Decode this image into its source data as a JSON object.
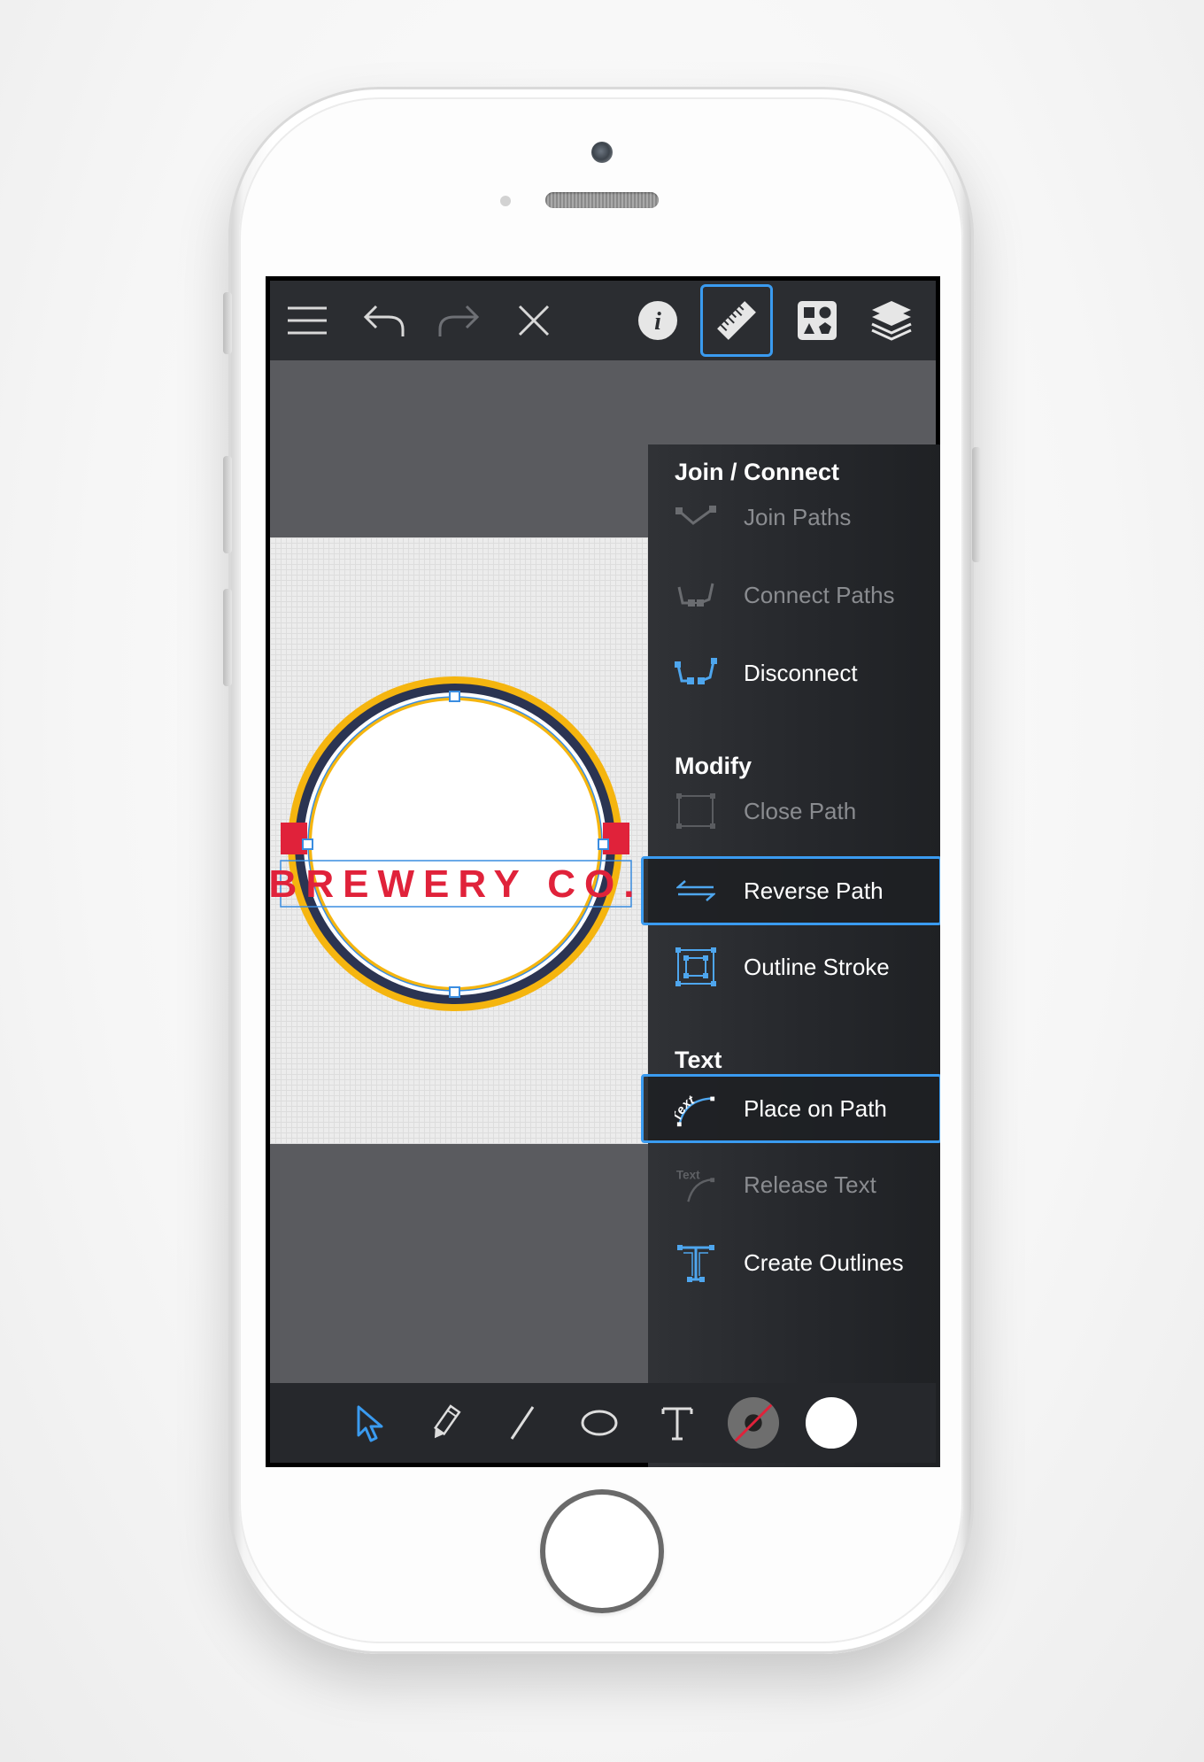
{
  "toolbar": {
    "icons": [
      "menu-icon",
      "undo-icon",
      "redo-icon",
      "close-icon",
      "info-icon",
      "ruler-icon",
      "shapes-icon",
      "layers-icon"
    ],
    "active": "ruler-icon",
    "accent": "#3a9bf0"
  },
  "artwork": {
    "text": "BREWERY CO.",
    "colors": {
      "ring": "#f5b50f",
      "inner_ring": "#2b3452",
      "text": "#e0223a",
      "selection": "#3a8de0"
    }
  },
  "panel": {
    "sections": [
      {
        "title": "Join / Connect",
        "items": [
          {
            "label": "Join Paths",
            "icon": "join-paths-icon",
            "state": "disabled"
          },
          {
            "label": "Connect Paths",
            "icon": "connect-paths-icon",
            "state": "disabled"
          },
          {
            "label": "Disconnect",
            "icon": "disconnect-icon",
            "state": "enabled"
          }
        ]
      },
      {
        "title": "Modify",
        "items": [
          {
            "label": "Close Path",
            "icon": "close-path-icon",
            "state": "disabled"
          },
          {
            "label": "Reverse Path",
            "icon": "reverse-path-icon",
            "state": "selected"
          },
          {
            "label": "Outline Stroke",
            "icon": "outline-stroke-icon",
            "state": "enabled"
          }
        ]
      },
      {
        "title": "Text",
        "items": [
          {
            "label": "Place on Path",
            "icon": "place-on-path-icon",
            "state": "selected",
            "icon_text": "Text"
          },
          {
            "label": "Release Text",
            "icon": "release-text-icon",
            "state": "disabled",
            "icon_text": "Text"
          },
          {
            "label": "Create Outlines",
            "icon": "create-outlines-icon",
            "state": "enabled"
          }
        ]
      }
    ]
  },
  "selection_toggle": {
    "options": [
      "direct-select-icon",
      "group-select-icon"
    ],
    "active": "direct-select-icon"
  },
  "bottom_tools": {
    "icons": [
      "selection-tool-icon",
      "pencil-tool-icon",
      "line-tool-icon",
      "ellipse-tool-icon",
      "text-tool-icon",
      "stroke-color-icon",
      "fill-color-icon"
    ],
    "active": "selection-tool-icon",
    "fill_color": "#ffffff"
  }
}
